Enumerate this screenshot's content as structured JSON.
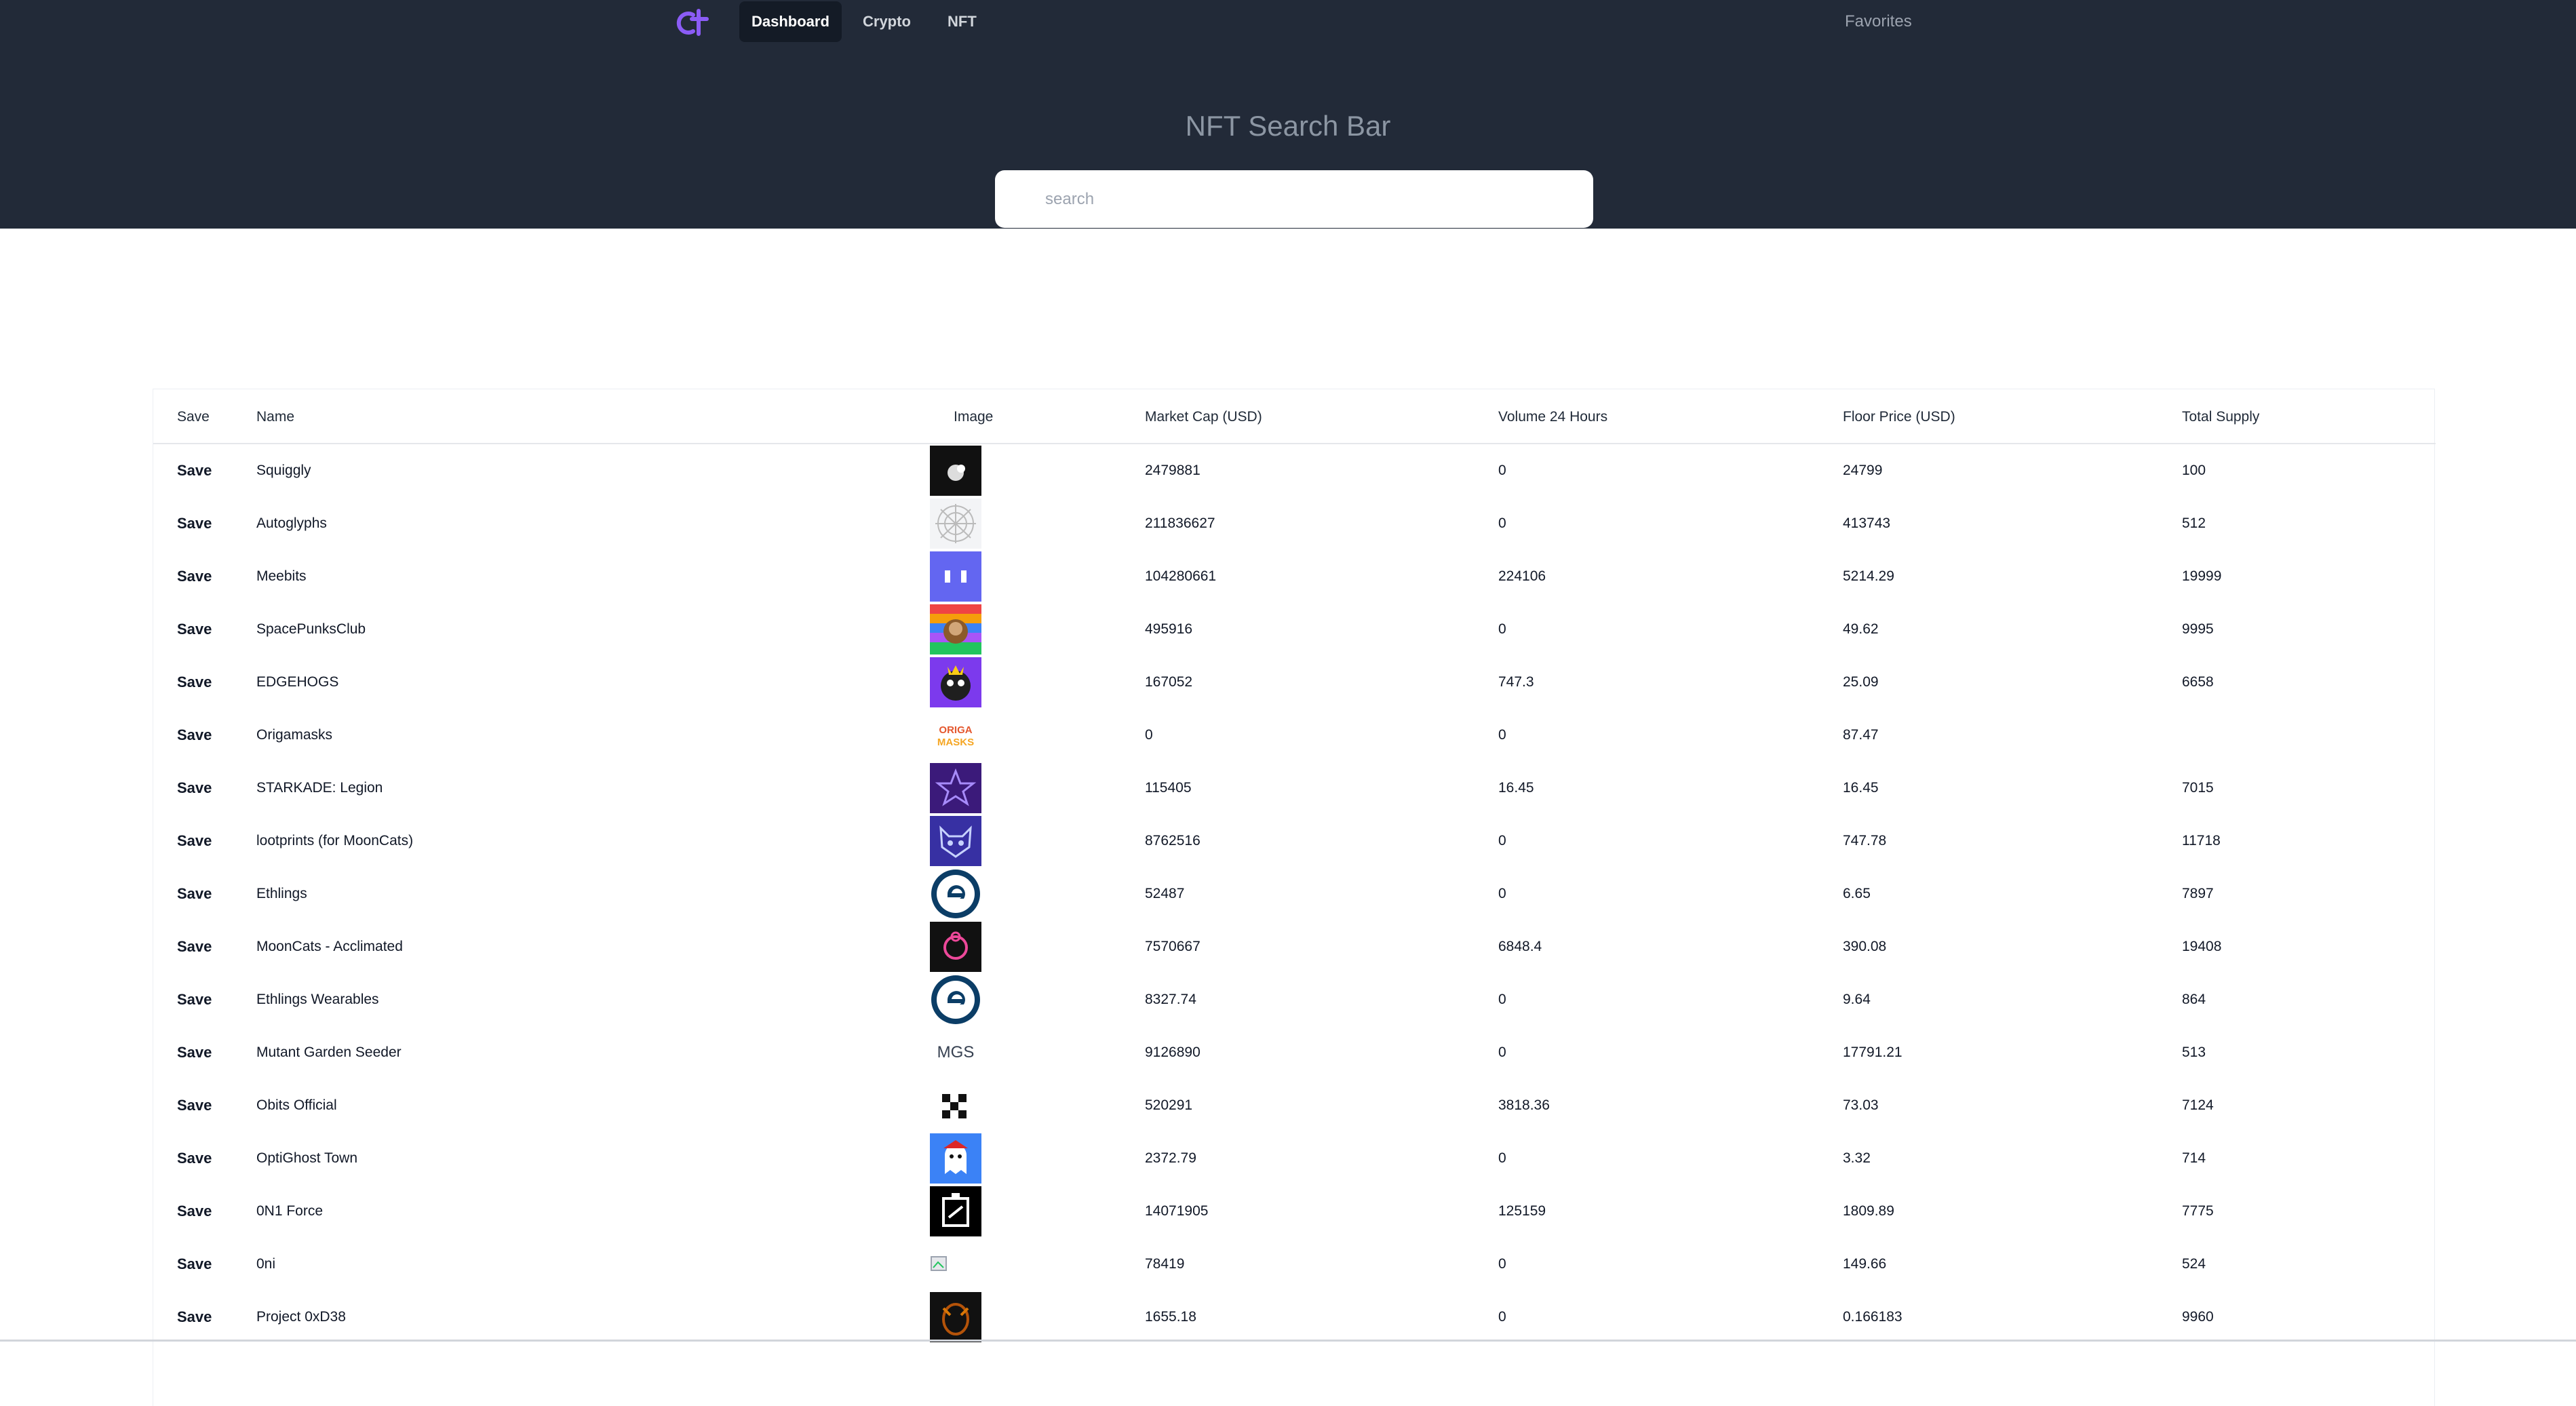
{
  "nav": {
    "logo_icon": "brand-logo-icon",
    "tabs": [
      {
        "label": "Dashboard",
        "active": true
      },
      {
        "label": "Crypto",
        "active": false
      },
      {
        "label": "NFT",
        "active": false
      }
    ],
    "favorites_label": "Favorites"
  },
  "search": {
    "title": "NFT Search Bar",
    "placeholder": "search",
    "value": ""
  },
  "colors": {
    "header_bg": "#222a38",
    "accent": "#8b5cf6"
  },
  "table": {
    "columns": [
      "Save",
      "Name",
      "Image",
      "Market Cap (USD)",
      "Volume 24 Hours",
      "Floor Price (USD)",
      "Total Supply"
    ],
    "save_label": "Save",
    "rows": [
      {
        "name": "Squiggly",
        "image": "squiggly-thumbnail",
        "market_cap": "2479881",
        "volume_24h": "0",
        "floor_price": "24799",
        "total_supply": "100"
      },
      {
        "name": "Autoglyphs",
        "image": "autoglyphs-thumbnail",
        "market_cap": "211836627",
        "volume_24h": "0",
        "floor_price": "413743",
        "total_supply": "512"
      },
      {
        "name": "Meebits",
        "image": "meebits-thumbnail",
        "market_cap": "104280661",
        "volume_24h": "224106",
        "floor_price": "5214.29",
        "total_supply": "19999"
      },
      {
        "name": "SpacePunksClub",
        "image": "spacepunksclub-thumbnail",
        "market_cap": "495916",
        "volume_24h": "0",
        "floor_price": "49.62",
        "total_supply": "9995"
      },
      {
        "name": "EDGEHOGS",
        "image": "edgehogs-thumbnail",
        "market_cap": "167052",
        "volume_24h": "747.3",
        "floor_price": "25.09",
        "total_supply": "6658"
      },
      {
        "name": "Origamasks",
        "image": "origamasks-thumbnail",
        "image_text": "ORIGA MASKS",
        "market_cap": "0",
        "volume_24h": "0",
        "floor_price": "87.47",
        "total_supply": ""
      },
      {
        "name": "STARKADE: Legion",
        "image": "starkade-thumbnail",
        "market_cap": "115405",
        "volume_24h": "16.45",
        "floor_price": "16.45",
        "total_supply": "7015"
      },
      {
        "name": "lootprints (for MoonCats)",
        "image": "lootprints-thumbnail",
        "market_cap": "8762516",
        "volume_24h": "0",
        "floor_price": "747.78",
        "total_supply": "11718"
      },
      {
        "name": "Ethlings",
        "image": "ethlings-thumbnail",
        "market_cap": "52487",
        "volume_24h": "0",
        "floor_price": "6.65",
        "total_supply": "7897"
      },
      {
        "name": "MoonCats - Acclimated",
        "image": "mooncats-thumbnail",
        "market_cap": "7570667",
        "volume_24h": "6848.4",
        "floor_price": "390.08",
        "total_supply": "19408"
      },
      {
        "name": "Ethlings Wearables",
        "image": "ethlings-wearables-thumbnail",
        "market_cap": "8327.74",
        "volume_24h": "0",
        "floor_price": "9.64",
        "total_supply": "864"
      },
      {
        "name": "Mutant Garden Seeder",
        "image": "mutant-garden-thumbnail",
        "image_text": "MGS",
        "market_cap": "9126890",
        "volume_24h": "0",
        "floor_price": "17791.21",
        "total_supply": "513"
      },
      {
        "name": "Obits Official",
        "image": "obits-thumbnail",
        "market_cap": "520291",
        "volume_24h": "3818.36",
        "floor_price": "73.03",
        "total_supply": "7124"
      },
      {
        "name": "OptiGhost Town",
        "image": "optighost-thumbnail",
        "market_cap": "2372.79",
        "volume_24h": "0",
        "floor_price": "3.32",
        "total_supply": "714"
      },
      {
        "name": "0N1 Force",
        "image": "0n1-force-thumbnail",
        "market_cap": "14071905",
        "volume_24h": "125159",
        "floor_price": "1809.89",
        "total_supply": "7775"
      },
      {
        "name": "0ni",
        "image": "broken-image-icon",
        "market_cap": "78419",
        "volume_24h": "0",
        "floor_price": "149.66",
        "total_supply": "524"
      },
      {
        "name": "Project 0xD38",
        "image": "project-0xd38-thumbnail",
        "market_cap": "1655.18",
        "volume_24h": "0",
        "floor_price": "0.166183",
        "total_supply": "9960"
      }
    ]
  }
}
